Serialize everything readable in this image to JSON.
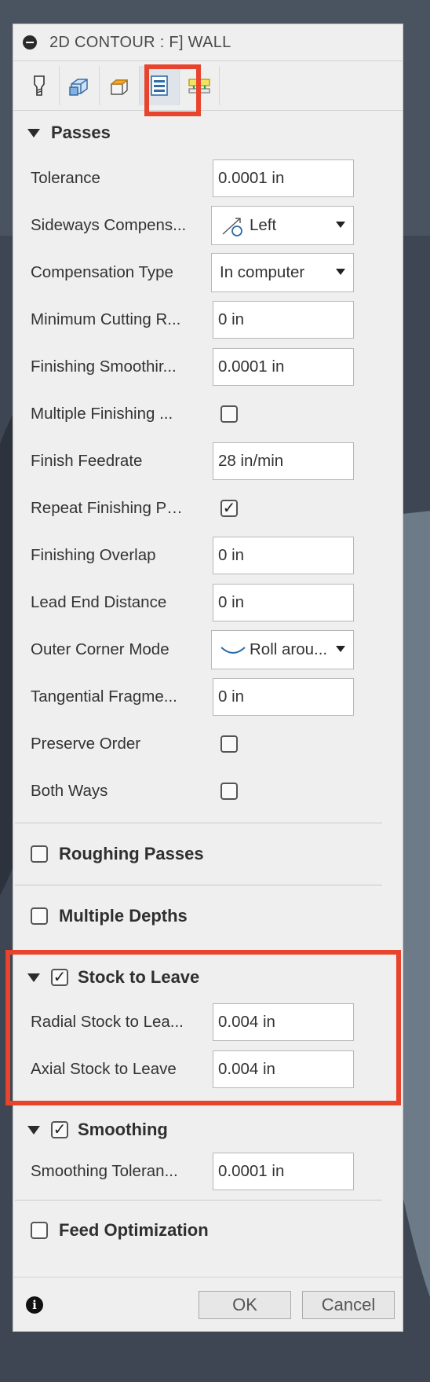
{
  "dialog": {
    "title": "2D CONTOUR : F] WALL"
  },
  "tabs": [
    {
      "icon": "tool-icon"
    },
    {
      "icon": "geometry-icon"
    },
    {
      "icon": "heights-icon"
    },
    {
      "icon": "passes-icon",
      "active": true
    },
    {
      "icon": "linking-icon"
    }
  ],
  "passes": {
    "header": "Passes",
    "tolerance": {
      "label": "Tolerance",
      "value": "0.0001 in"
    },
    "sideways_compensation": {
      "label": "Sideways Compens...",
      "value": "Left"
    },
    "compensation_type": {
      "label": "Compensation Type",
      "value": "In computer"
    },
    "minimum_cutting": {
      "label": "Minimum Cutting R...",
      "value": "0 in"
    },
    "finishing_smoothing": {
      "label": "Finishing Smoothir...",
      "value": "0.0001 in"
    },
    "multiple_finishing": {
      "label": "Multiple Finishing ...",
      "checked": false
    },
    "finish_feedrate": {
      "label": "Finish Feedrate",
      "value": "28 in/min"
    },
    "repeat_finishing": {
      "label": "Repeat Finishing Pa...",
      "checked": true
    },
    "finishing_overlap": {
      "label": "Finishing Overlap",
      "value": "0 in"
    },
    "lead_end_distance": {
      "label": "Lead End Distance",
      "value": "0 in"
    },
    "outer_corner_mode": {
      "label": "Outer Corner Mode",
      "value": "Roll arou..."
    },
    "tangential_fragment": {
      "label": "Tangential Fragme...",
      "value": "0 in"
    },
    "preserve_order": {
      "label": "Preserve Order",
      "checked": false
    },
    "both_ways": {
      "label": "Both Ways",
      "checked": false
    }
  },
  "roughing_passes": {
    "label": "Roughing Passes",
    "checked": false
  },
  "multiple_depths": {
    "label": "Multiple Depths",
    "checked": false
  },
  "stock_to_leave": {
    "label": "Stock to Leave",
    "checked": true,
    "radial": {
      "label": "Radial Stock to Lea...",
      "value": "0.004 in"
    },
    "axial": {
      "label": "Axial Stock to Leave",
      "value": "0.004 in"
    }
  },
  "smoothing": {
    "label": "Smoothing",
    "checked": true,
    "tolerance": {
      "label": "Smoothing Toleran...",
      "value": "0.0001 in"
    }
  },
  "feed_optimization": {
    "label": "Feed Optimization",
    "checked": false
  },
  "footer": {
    "ok": "OK",
    "cancel": "Cancel",
    "info_icon": "i"
  },
  "colors": {
    "highlight": "#e8432c",
    "panel": "#efefef"
  }
}
